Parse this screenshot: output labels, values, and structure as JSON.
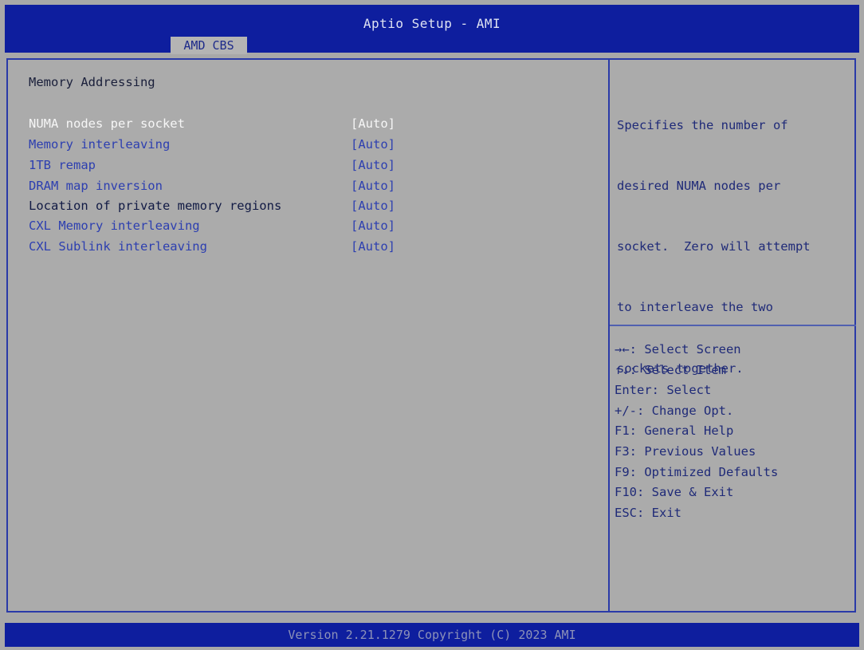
{
  "app": {
    "title": "Aptio Setup - AMI",
    "tabs": [
      {
        "label": "AMD CBS"
      }
    ]
  },
  "main": {
    "section_title": "Memory Addressing",
    "settings": [
      {
        "label": "NUMA nodes per socket",
        "value": "[Auto]",
        "selected": true
      },
      {
        "label": "Memory interleaving",
        "value": "[Auto]"
      },
      {
        "label": "1TB remap",
        "value": "[Auto]"
      },
      {
        "label": "DRAM map inversion",
        "value": "[Auto]"
      },
      {
        "label": "Location of private memory regions",
        "value": "[Auto]"
      },
      {
        "label": "CXL Memory interleaving",
        "value": "[Auto]"
      },
      {
        "label": "CXL Sublink interleaving",
        "value": "[Auto]"
      }
    ]
  },
  "help": {
    "lines": [
      "Specifies the number of",
      "desired NUMA nodes per",
      "socket.  Zero will attempt",
      "to interleave the two",
      "sockets together."
    ]
  },
  "keys": [
    "→←: Select Screen",
    "↑↓: Select Item",
    "Enter: Select",
    "+/-: Change Opt.",
    "F1: General Help",
    "F3: Previous Values",
    "F9: Optimized Defaults",
    "F10: Save & Exit",
    "ESC: Exit"
  ],
  "footer": {
    "text": "Version 2.21.1279 Copyright (C) 2023 AMI"
  },
  "colors": {
    "bar_blue": "#0e1e9e",
    "panel_gray": "#a8a8a8",
    "item_blue": "#2d3fb0",
    "selected_white": "#f6f6f6"
  }
}
